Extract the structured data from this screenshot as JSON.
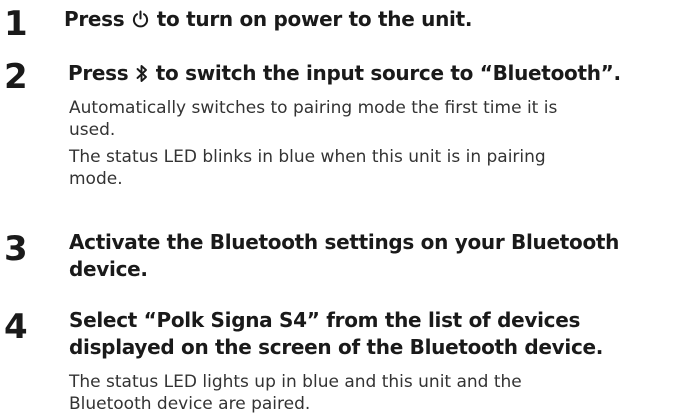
{
  "steps": [
    {
      "number": "1",
      "heading_pre": "Press",
      "icon": "power-icon",
      "heading_post": "to turn on power to the unit."
    },
    {
      "number": "2",
      "heading_pre": "Press",
      "icon": "bluetooth-icon",
      "heading_post": "to switch the input source to “Bluetooth”.",
      "notes": [
        [
          "Automatically switches to pairing mode the first time it is",
          "used."
        ],
        [
          "The status LED blinks in blue when this unit is in pairing",
          "mode."
        ]
      ]
    },
    {
      "number": "3",
      "heading_lines": [
        "Activate the Bluetooth settings on your Bluetooth",
        "device."
      ]
    },
    {
      "number": "4",
      "heading_lines": [
        "Select “Polk Signa S4” from the list of devices",
        "displayed on the screen of the Bluetooth device."
      ],
      "notes": [
        [
          "The status LED lights up in blue and this unit and the",
          "Bluetooth device are paired."
        ]
      ]
    }
  ]
}
